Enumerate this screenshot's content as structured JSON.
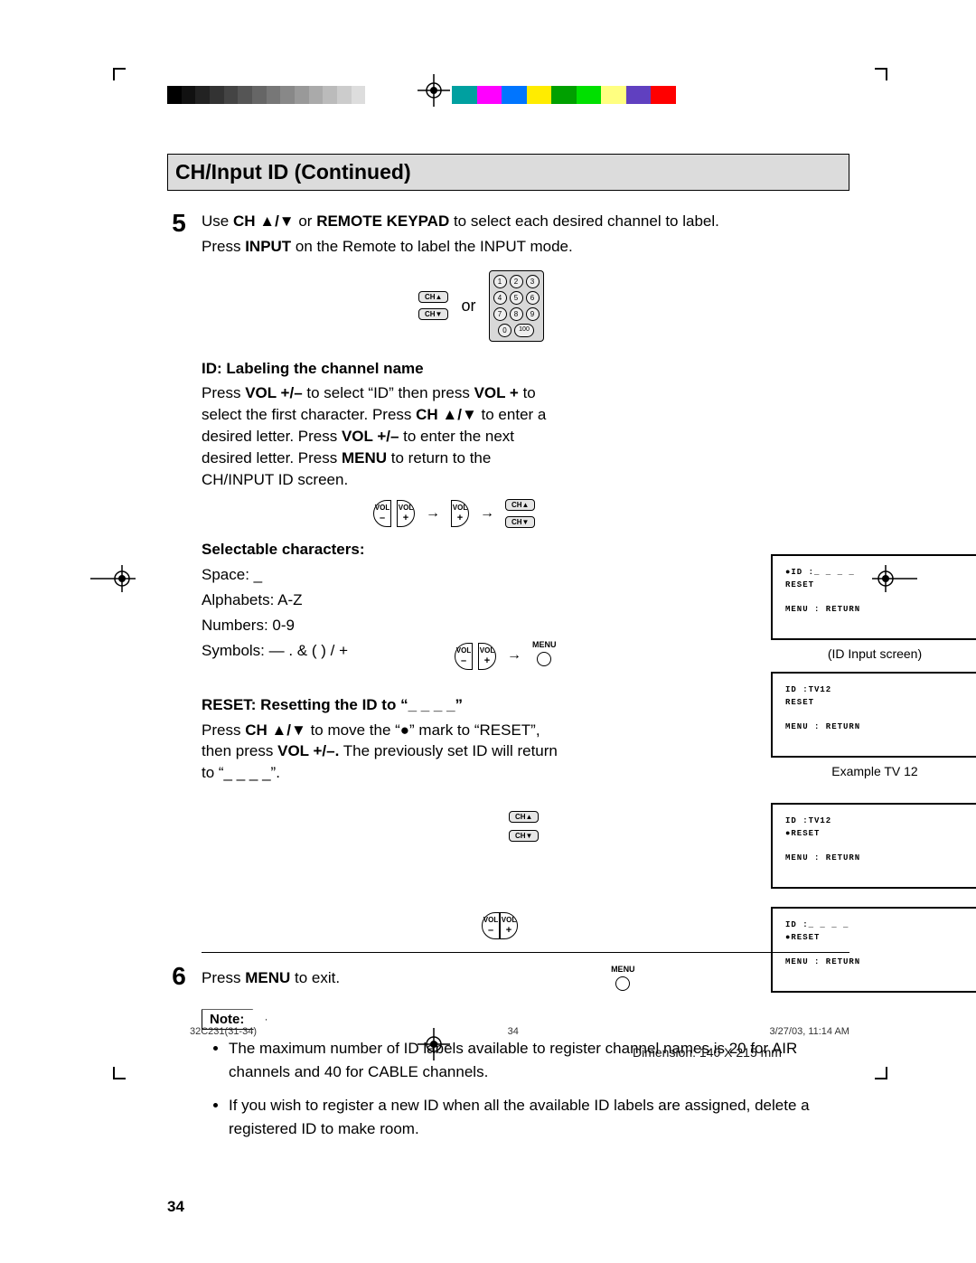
{
  "title": "CH/Input ID (Continued)",
  "step5": {
    "num": "5",
    "line1a": "Use ",
    "line1b": "CH ▲/▼",
    "line1c": " or ",
    "line1d": "REMOTE KEYPAD",
    "line1e": " to select each desired channel to label.",
    "line2a": "Press ",
    "line2b": "INPUT",
    "line2c": " on the Remote to label the INPUT mode.",
    "or": "or",
    "ch_up": "CH▲",
    "ch_dn": "CH▼",
    "keypad": [
      "1",
      "2",
      "3",
      "4",
      "5",
      "6",
      "7",
      "8",
      "9",
      "0",
      "100"
    ],
    "id_head": "ID: Labeling the channel name",
    "id_p1a": "Press ",
    "id_p1b": "VOL +/–",
    "id_p1c": " to select “ID” then press  ",
    "id_p1d": "VOL +",
    "id_p1e": " to select the first character. Press ",
    "id_p1f": "CH ▲/▼",
    "id_p1g": " to enter a desired letter. Press ",
    "id_p1h": "VOL +/–",
    "id_p1i": " to enter the next desired letter. Press ",
    "id_p1j": "MENU",
    "id_p1k": " to return to the CH/INPUT ID screen.",
    "sel_head": "Selectable characters:",
    "sel_1": "Space: _",
    "sel_2": "Alphabets: A-Z",
    "sel_3": "Numbers: 0-9",
    "sel_4": "Symbols: —  .  &  (  )  /  +",
    "reset_head": "RESET: Resetting the ID to “_ _ _ _”",
    "reset_p_a": "Press ",
    "reset_p_b": "CH ▲/▼",
    "reset_p_c": " to move the “●” mark to “RESET”, then press ",
    "reset_p_d": "VOL +/–.",
    "reset_p_e": " The previously set ID will return to “_ _ _ _”.",
    "vol": "VOL",
    "menu": "MENU"
  },
  "osd": {
    "a_l1": "●ID   :_ _ _ _",
    "a_l2": " RESET",
    "a_l3": "MENU : RETURN",
    "a_cap": "(ID Input screen)",
    "b_l1": " ID   :TV12",
    "b_l2": " RESET",
    "b_l3": "MENU : RETURN",
    "b_cap": "Example TV 12",
    "c_l1": " ID   :TV12",
    "c_l2": "●RESET",
    "c_l3": "MENU : RETURN",
    "d_l1": " ID   :_ _ _ _",
    "d_l2": "●RESET",
    "d_l3": "MENU : RETURN"
  },
  "step6": {
    "num": "6",
    "text_a": "Press ",
    "text_b": "MENU",
    "text_c": " to exit."
  },
  "note": {
    "label": "Note:",
    "b1": "The maximum number of ID labels available to register channel names is 20 for AIR channels and 40 for CABLE channels.",
    "b2": "If you wish to register a new ID when all the available ID labels are assigned, delete a registered ID to make room."
  },
  "page_no": "34",
  "footer": {
    "left": "32C231(31-34)",
    "mid": "34",
    "right": "3/27/03, 11:14 AM",
    "dim": "Dimension: 140  X 215 mm"
  },
  "grayscale": [
    "#000",
    "#111",
    "#222",
    "#333",
    "#444",
    "#555",
    "#666",
    "#777",
    "#888",
    "#999",
    "#aaa",
    "#bbb",
    "#ccc",
    "#ddd",
    "#fff"
  ],
  "colors": [
    "#00a0a0",
    "#ff00ff",
    "#0075ff",
    "#ffec00",
    "#00a000",
    "#00e000",
    "#ffff80",
    "#6040c0",
    "#ff0000",
    "#fff"
  ]
}
